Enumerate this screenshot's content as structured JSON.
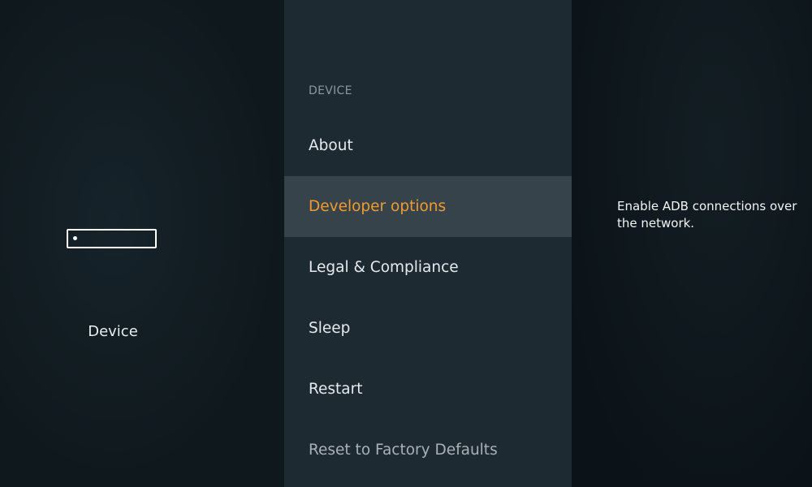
{
  "left_panel": {
    "category_label": "Device",
    "icon": "fire-tv-device-icon"
  },
  "menu": {
    "section_header": "DEVICE",
    "items": [
      {
        "label": "About",
        "selected": false
      },
      {
        "label": "Developer options",
        "selected": true
      },
      {
        "label": "Legal & Compliance",
        "selected": false
      },
      {
        "label": "Sleep",
        "selected": false
      },
      {
        "label": "Restart",
        "selected": false
      },
      {
        "label": "Reset to Factory Defaults",
        "selected": false
      }
    ]
  },
  "detail": {
    "description": "Enable ADB connections over the network."
  },
  "colors": {
    "accent": "#f29a2e",
    "menu_background": "#1e2a32",
    "selected_background": "#36434b",
    "screen_background": "#0f181d"
  }
}
